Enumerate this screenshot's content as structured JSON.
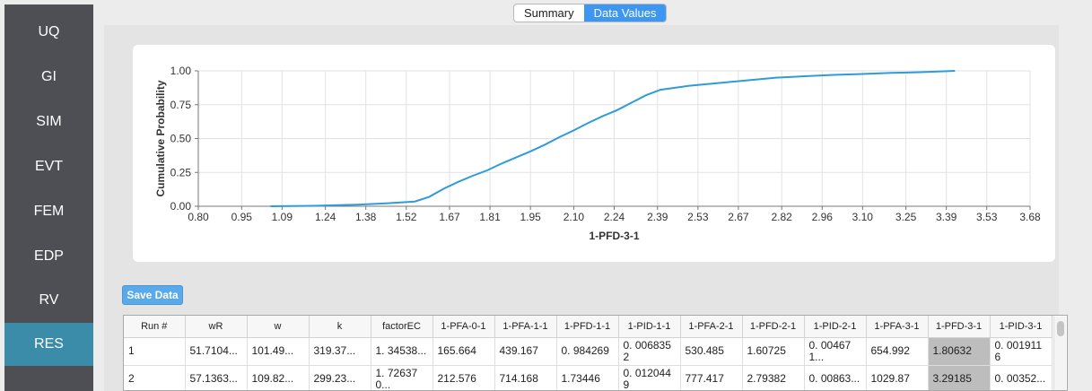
{
  "sidebar": {
    "items": [
      {
        "label": "UQ",
        "active": false
      },
      {
        "label": "GI",
        "active": false
      },
      {
        "label": "SIM",
        "active": false
      },
      {
        "label": "EVT",
        "active": false
      },
      {
        "label": "FEM",
        "active": false
      },
      {
        "label": "EDP",
        "active": false
      },
      {
        "label": "RV",
        "active": false
      },
      {
        "label": "RES",
        "active": true
      }
    ]
  },
  "tabs": [
    {
      "label": "Summary",
      "active": false
    },
    {
      "label": "Data Values",
      "active": true
    }
  ],
  "colors": {
    "sidebar": "#4d4f55",
    "active_nav": "#3a8ca9",
    "accent": "#3d97f2",
    "line": "#2e9cdb",
    "save_button": "#5aa9ea"
  },
  "save_button_label": "Save Data",
  "chart_data": {
    "type": "line",
    "xlabel": "1-PFD-3-1",
    "ylabel": "Cumulative Probability",
    "xlim": [
      0.8,
      3.68
    ],
    "ylim": [
      0.0,
      1.0
    ],
    "x_ticks": [
      "0.80",
      "0.95",
      "1.09",
      "1.24",
      "1.38",
      "1.52",
      "1.67",
      "1.81",
      "1.95",
      "2.10",
      "2.24",
      "2.39",
      "2.53",
      "2.67",
      "2.82",
      "2.96",
      "3.10",
      "3.25",
      "3.39",
      "3.53",
      "3.68"
    ],
    "y_ticks": [
      "0.00",
      "0.25",
      "0.50",
      "0.75",
      "1.00"
    ],
    "grid": true,
    "series": [
      {
        "x": [
          1.05,
          1.2,
          1.35,
          1.45,
          1.55,
          1.6,
          1.65,
          1.7,
          1.75,
          1.8,
          1.85,
          1.9,
          1.95,
          2.0,
          2.05,
          2.1,
          2.15,
          2.2,
          2.25,
          2.3,
          2.35,
          2.4,
          2.5,
          2.6,
          2.7,
          2.8,
          2.9,
          3.0,
          3.1,
          3.2,
          3.3,
          3.42
        ],
        "y": [
          0.0,
          0.003,
          0.012,
          0.022,
          0.035,
          0.07,
          0.13,
          0.18,
          0.225,
          0.265,
          0.315,
          0.36,
          0.405,
          0.455,
          0.51,
          0.56,
          0.615,
          0.665,
          0.71,
          0.765,
          0.82,
          0.86,
          0.89,
          0.91,
          0.93,
          0.95,
          0.96,
          0.97,
          0.977,
          0.985,
          0.99,
          1.0
        ]
      }
    ]
  },
  "table": {
    "headers": [
      "Run #",
      "wR",
      "w",
      "k",
      "factorEC",
      "1-PFA-0-1",
      "1-PFA-1-1",
      "1-PFD-1-1",
      "1-PID-1-1",
      "1-PFA-2-1",
      "1-PFD-2-1",
      "1-PID-2-1",
      "1-PFA-3-1",
      "1-PFD-3-1",
      "1-PID-3-1"
    ],
    "rows": [
      [
        "1",
        "51.7104...",
        "101.49...",
        "319.37...",
        "1. 34538...",
        "165.664",
        "439.167",
        "0. 984269",
        "0. 0068352",
        "530.485",
        "1.60725",
        "0. 004671...",
        "654.992",
        "1.80632",
        "0. 0019116"
      ],
      [
        "2",
        "57.1363...",
        "109.82...",
        "299.23...",
        "1. 726370...",
        "212.576",
        "714.168",
        "1.73446",
        "0. 0120449",
        "777.417",
        "2.79382",
        "0. 00863...",
        "1029.87",
        "3.29185",
        "0. 00352..."
      ]
    ],
    "selected_column": 13
  }
}
